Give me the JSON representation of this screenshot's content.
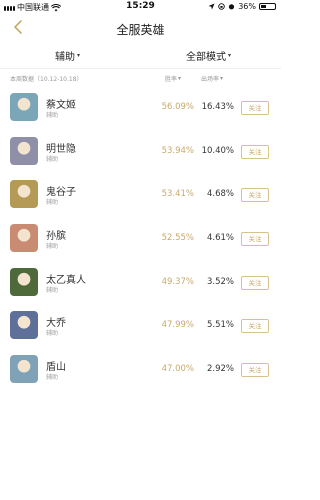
{
  "status_bar": {
    "carrier": "中国联通",
    "time": "15:29",
    "battery": "36%"
  },
  "nav": {
    "title": "全服英雄"
  },
  "filters": {
    "role": "辅助",
    "mode": "全部模式"
  },
  "subheader": {
    "period": "本周数据（10.12-10.18）",
    "win_rate_label": "胜率",
    "pick_rate_label": "出场率"
  },
  "heroes": [
    {
      "name": "蔡文姬",
      "role": "辅助",
      "win_rate": "56.09%",
      "pick_rate": "16.43%",
      "follow": "关注",
      "avatar_color": "#7aa6b8"
    },
    {
      "name": "明世隐",
      "role": "辅助",
      "win_rate": "53.94%",
      "pick_rate": "10.40%",
      "follow": "关注",
      "avatar_color": "#8f8fa8"
    },
    {
      "name": "鬼谷子",
      "role": "辅助",
      "win_rate": "53.41%",
      "pick_rate": "4.68%",
      "follow": "关注",
      "avatar_color": "#b49a55"
    },
    {
      "name": "孙膑",
      "role": "辅助",
      "win_rate": "52.55%",
      "pick_rate": "4.61%",
      "follow": "关注",
      "avatar_color": "#c98c72"
    },
    {
      "name": "太乙真人",
      "role": "辅助",
      "win_rate": "49.37%",
      "pick_rate": "3.52%",
      "follow": "关注",
      "avatar_color": "#4f6a3a"
    },
    {
      "name": "大乔",
      "role": "辅助",
      "win_rate": "47.99%",
      "pick_rate": "5.51%",
      "follow": "关注",
      "avatar_color": "#5e6f9a"
    },
    {
      "name": "盾山",
      "role": "辅助",
      "win_rate": "47.00%",
      "pick_rate": "2.92%",
      "follow": "关注",
      "avatar_color": "#7fa2b6"
    }
  ],
  "colors": {
    "accent_gold": "#c8a96a",
    "follow_border": "#d8c18f"
  }
}
